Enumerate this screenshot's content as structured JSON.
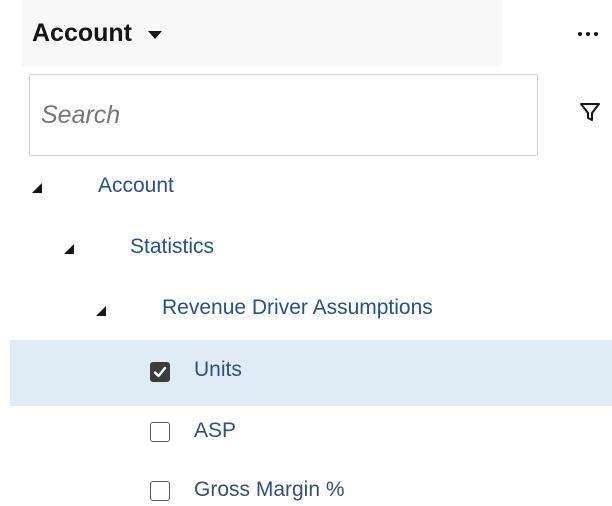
{
  "header": {
    "title": "Account"
  },
  "search": {
    "placeholder": "Search"
  },
  "icons": {
    "header_dropdown": "chevron-down-icon",
    "more": "more-horizontal-icon",
    "filter": "filter-icon",
    "expander": "expanded-triangle-icon",
    "checkbox_checked": "checkmark-icon"
  },
  "tree": {
    "nodes": [
      {
        "label": "Account",
        "expanded": true
      },
      {
        "label": "Statistics",
        "expanded": true
      },
      {
        "label": "Revenue Driver Assumptions",
        "expanded": true
      }
    ],
    "leaves": [
      {
        "label": "Units",
        "checked": true,
        "selected": true
      },
      {
        "label": "ASP",
        "checked": false,
        "selected": false
      },
      {
        "label": "Gross Margin %",
        "checked": false,
        "selected": false
      }
    ]
  },
  "colors": {
    "link_text": "#23538a",
    "selected_row": "#dfebf5",
    "header_bg": "#f8f8f8"
  }
}
